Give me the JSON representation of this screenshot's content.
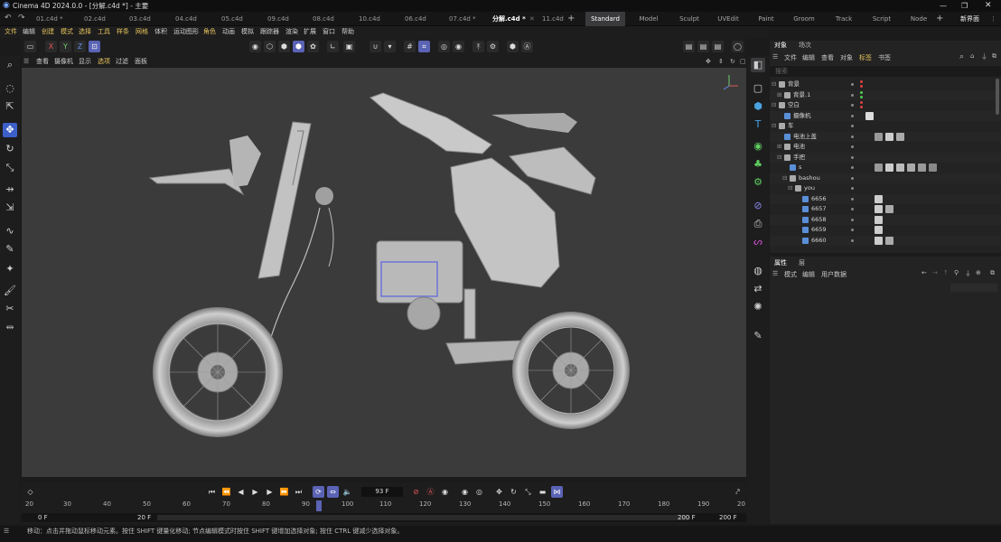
{
  "window": {
    "title": "Cinema 4D 2024.0.0 - [分解.c4d *] - 主要"
  },
  "doc_tabs": [
    {
      "label": "01.c4d *"
    },
    {
      "label": "02.c4d"
    },
    {
      "label": "03.c4d"
    },
    {
      "label": "04.c4d"
    },
    {
      "label": "05.c4d"
    },
    {
      "label": "09.c4d"
    },
    {
      "label": "08.c4d"
    },
    {
      "label": "10.c4d"
    },
    {
      "label": "06.c4d"
    },
    {
      "label": "07.c4d *"
    },
    {
      "label": "分解.c4d *"
    },
    {
      "label": "11.c4d"
    }
  ],
  "workspaces": [
    {
      "label": "Standard"
    },
    {
      "label": "Model"
    },
    {
      "label": "Sculpt"
    },
    {
      "label": "UVEdit"
    },
    {
      "label": "Paint"
    },
    {
      "label": "Groom"
    },
    {
      "label": "Track"
    },
    {
      "label": "Script"
    },
    {
      "label": "Node"
    }
  ],
  "new_interface": "新界面",
  "menu": [
    "文件",
    "编辑",
    "创建",
    "模式",
    "选择",
    "工具",
    "样条",
    "网格",
    "体积",
    "运动图形",
    "角色",
    "动画",
    "模拟",
    "跟踪器",
    "渲染",
    "扩展",
    "窗口",
    "帮助"
  ],
  "axis_buttons": {
    "x": "X",
    "y": "Y",
    "z": "Z"
  },
  "viewport_menu": [
    "查看",
    "摄像机",
    "显示",
    "选项",
    "过滤",
    "面板"
  ],
  "object_panel": {
    "tabs": [
      "对象",
      "场次"
    ],
    "menu": [
      "文件",
      "编辑",
      "查看",
      "对象",
      "标签",
      "书签"
    ],
    "search_placeholder": "搜索",
    "rows": [
      {
        "name": "背景"
      },
      {
        "name": "背景.1"
      },
      {
        "name": "空白"
      },
      {
        "name": "摄像机"
      },
      {
        "name": "车"
      },
      {
        "name": "电池上盖"
      },
      {
        "name": "电池"
      },
      {
        "name": "手把"
      },
      {
        "name": "s"
      },
      {
        "name": "bashou"
      },
      {
        "name": "you"
      },
      {
        "name": "6656"
      },
      {
        "name": "6657"
      },
      {
        "name": "6658"
      },
      {
        "name": "6659"
      },
      {
        "name": "6660"
      }
    ]
  },
  "attr_panel": {
    "tabs": [
      "属性",
      "层"
    ],
    "menu": [
      "模式",
      "编辑",
      "用户数据"
    ]
  },
  "timeline": {
    "current_frame": "93 F",
    "start": "0 F",
    "preview_start": "20 F",
    "preview_end": "200 F",
    "end": "200 F",
    "ruler": [
      "20",
      "30",
      "40",
      "50",
      "60",
      "70",
      "80",
      "90",
      "100",
      "110",
      "120",
      "130",
      "140",
      "150",
      "160",
      "170",
      "180",
      "190",
      "20"
    ]
  },
  "status": "移动：点击并拖动鼠标移动元素。按住 SHIFT 键量化移动; 节点编辑模式时按住 SHIFT 键增加选择对象; 按住 CTRL 键减少选择对象。",
  "colors": {
    "accent": "#5a63b4",
    "viewport_bg": "#3b3b3b",
    "panel_bg": "#232324"
  }
}
